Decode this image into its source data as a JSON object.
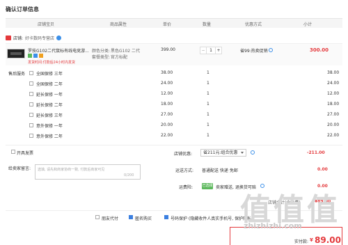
{
  "page_title": "确认订单信息",
  "table_headers": {
    "shop": "店铺宝贝",
    "attr": "商品属性",
    "price": "单价",
    "qty": "数量",
    "discount": "优惠方式",
    "subtotal": "小计"
  },
  "shop": {
    "label": "店铺:",
    "name": "好卡数码专营店"
  },
  "item": {
    "name": "罗技G102二代鼠标有线电竞游...",
    "color_label": "颜色分类:",
    "color_value": "黑色G102 二代",
    "package_label": "套餐类型:",
    "package_value": "官方标配",
    "promo": "发货时间:付款后24小时内发货",
    "price": "399.00",
    "qty": "1",
    "qty_minus": "−",
    "qty_plus": "+",
    "discount": "省99:热卖促销",
    "subtotal": "300.00"
  },
  "services": {
    "label": "售后服务",
    "options": [
      {
        "name": "全国保修 三年",
        "price": "38.00",
        "qty": "1",
        "subtotal": "38.00",
        "checked": false
      },
      {
        "name": "全国保修 二年",
        "price": "24.00",
        "qty": "1",
        "subtotal": "24.00",
        "checked": false
      },
      {
        "name": "延长保修 一年",
        "price": "12.00",
        "qty": "1",
        "subtotal": "12.00",
        "checked": false
      },
      {
        "name": "延长保修 二年",
        "price": "18.00",
        "qty": "1",
        "subtotal": "18.00",
        "checked": false
      },
      {
        "name": "延长保修 三年",
        "price": "27.00",
        "qty": "1",
        "subtotal": "27.00",
        "checked": false
      },
      {
        "name": "意外保修 一年",
        "price": "20.00",
        "qty": "1",
        "subtotal": "20.00",
        "checked": false
      },
      {
        "name": "意外保修 二年",
        "price": "22.00",
        "qty": "1",
        "subtotal": "22.00",
        "checked": false
      }
    ]
  },
  "invoice": {
    "label": "开具发票"
  },
  "shop_discount": {
    "label": "店铺优惠:",
    "value": "省211元:组合优惠",
    "amount": "-211.00"
  },
  "message": {
    "label": "给卖家留言:",
    "placeholder": "选填, 请先和商家协商一致, 付款后商家可见",
    "counter": "0/200"
  },
  "shipping": {
    "label": "运送方式:",
    "value": "普通配送 快递 免邮",
    "amount": "0.00"
  },
  "insurance": {
    "label": "运费险:",
    "tag": "已选择",
    "value": "卖家赠送, 退换货可赔",
    "amount": "0.00"
  },
  "subtotal_row": {
    "label": "店铺合计(含运费)",
    "amount": "¥89.00"
  },
  "bottom": {
    "pay_for_me": "朋友代付",
    "anonymous": "匿名购买",
    "privacy": "号码保护 (隐藏收件人真实手机号, 保护隐私)"
  },
  "total": {
    "label": "实付款:",
    "currency": "¥",
    "amount": "89.00"
  },
  "watermark": {
    "chars": "值值值",
    "url": "zhizhizhi.com"
  },
  "colors": {
    "accent": "#e4393c",
    "link": "#3b8fe8",
    "check": "#3b7fe0"
  }
}
